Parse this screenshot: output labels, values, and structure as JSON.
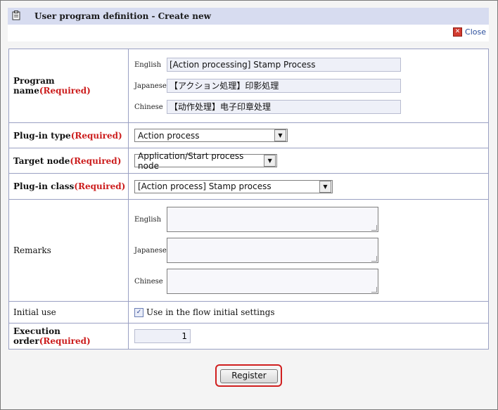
{
  "dialog": {
    "title": "User program definition - Create new",
    "close_label": "Close",
    "register_label": "Register"
  },
  "form": {
    "program_name": {
      "label": "Program name",
      "required": "(Required)",
      "english_label": "English",
      "english_value": "[Action processing] Stamp Process",
      "japanese_label": "Japanese",
      "japanese_value": "【アクション処理】印影処理",
      "chinese_label": "Chinese",
      "chinese_value": "【动作处理】电子印章处理"
    },
    "plugin_type": {
      "label": "Plug-in type",
      "required": "(Required)",
      "selected": "Action process"
    },
    "target_node": {
      "label": "Target node",
      "required": "(Required)",
      "selected": "Application/Start process node"
    },
    "plugin_class": {
      "label": "Plug-in class",
      "required": "(Required)",
      "selected": "[Action process] Stamp process"
    },
    "remarks": {
      "label": "Remarks",
      "english_label": "English",
      "japanese_label": "Japanese",
      "chinese_label": "Chinese"
    },
    "initial_use": {
      "label": "Initial use",
      "checkbox_label": "Use in the flow initial settings",
      "checked": true
    },
    "execution_order": {
      "label": "Execution order",
      "required": "(Required)",
      "value": "1"
    }
  },
  "icons": {
    "title": "clipboard-icon",
    "close": "close-icon",
    "dropdown": "chevron-down-icon"
  },
  "colors": {
    "required": "#cc1d1d",
    "titlebar": "#d7dcf0",
    "highlight": "#d01f1f"
  }
}
